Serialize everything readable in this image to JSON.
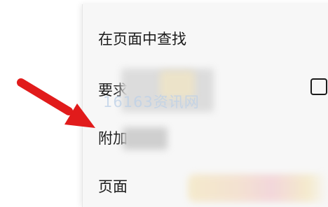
{
  "menu": {
    "items": [
      {
        "label": "在页面中查找"
      },
      {
        "label": "要求"
      },
      {
        "label": "附加"
      },
      {
        "label": "页面"
      }
    ],
    "desktop_checkbox_checked": false
  },
  "watermark": {
    "text": "16163资讯网"
  },
  "annotation": {
    "arrow_icon": "red-arrow",
    "arrow_color": "#e11b1b"
  },
  "colors": {
    "panel_bg": "#f7f7f7",
    "text": "#1b1b1b"
  }
}
